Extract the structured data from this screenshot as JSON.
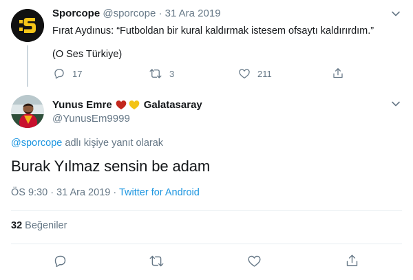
{
  "tweet1": {
    "name": "Sporcope",
    "handle": "@sporcope",
    "separator": "·",
    "date": "31 Ara 2019",
    "text": "Fırat Aydınus: “Futboldan bir kural kaldırmak istesem ofsaytı kaldırırdım.”",
    "source": "(O Ses Türkiye)",
    "reply_count": "17",
    "retweet_count": "3",
    "like_count": "211",
    "avatar_text": ":S"
  },
  "tweet2": {
    "name": "Yunus Emre",
    "name_suffix": "Galatasaray",
    "handle": "@YunusEm9999",
    "reply_to_handle": "@sporcope",
    "reply_to_suffix": " adlı kişiye yanıt olarak",
    "text": "Burak Yılmaz sensin be adam",
    "time": "ÖS 9:30",
    "separator": "·",
    "date": "31 Ara 2019",
    "source": "Twitter for Android",
    "likes_count": "32",
    "likes_label": "Beğeniler"
  },
  "colors": {
    "accent": "#1b95e0",
    "muted": "#657786",
    "sporcope_yellow": "#f5c518",
    "heart_red": "#c2271d",
    "heart_yellow": "#f3c316"
  },
  "icons": [
    "chevron-down-icon",
    "reply-icon",
    "retweet-icon",
    "like-icon",
    "share-icon",
    "red-heart-emoji",
    "yellow-heart-emoji"
  ]
}
